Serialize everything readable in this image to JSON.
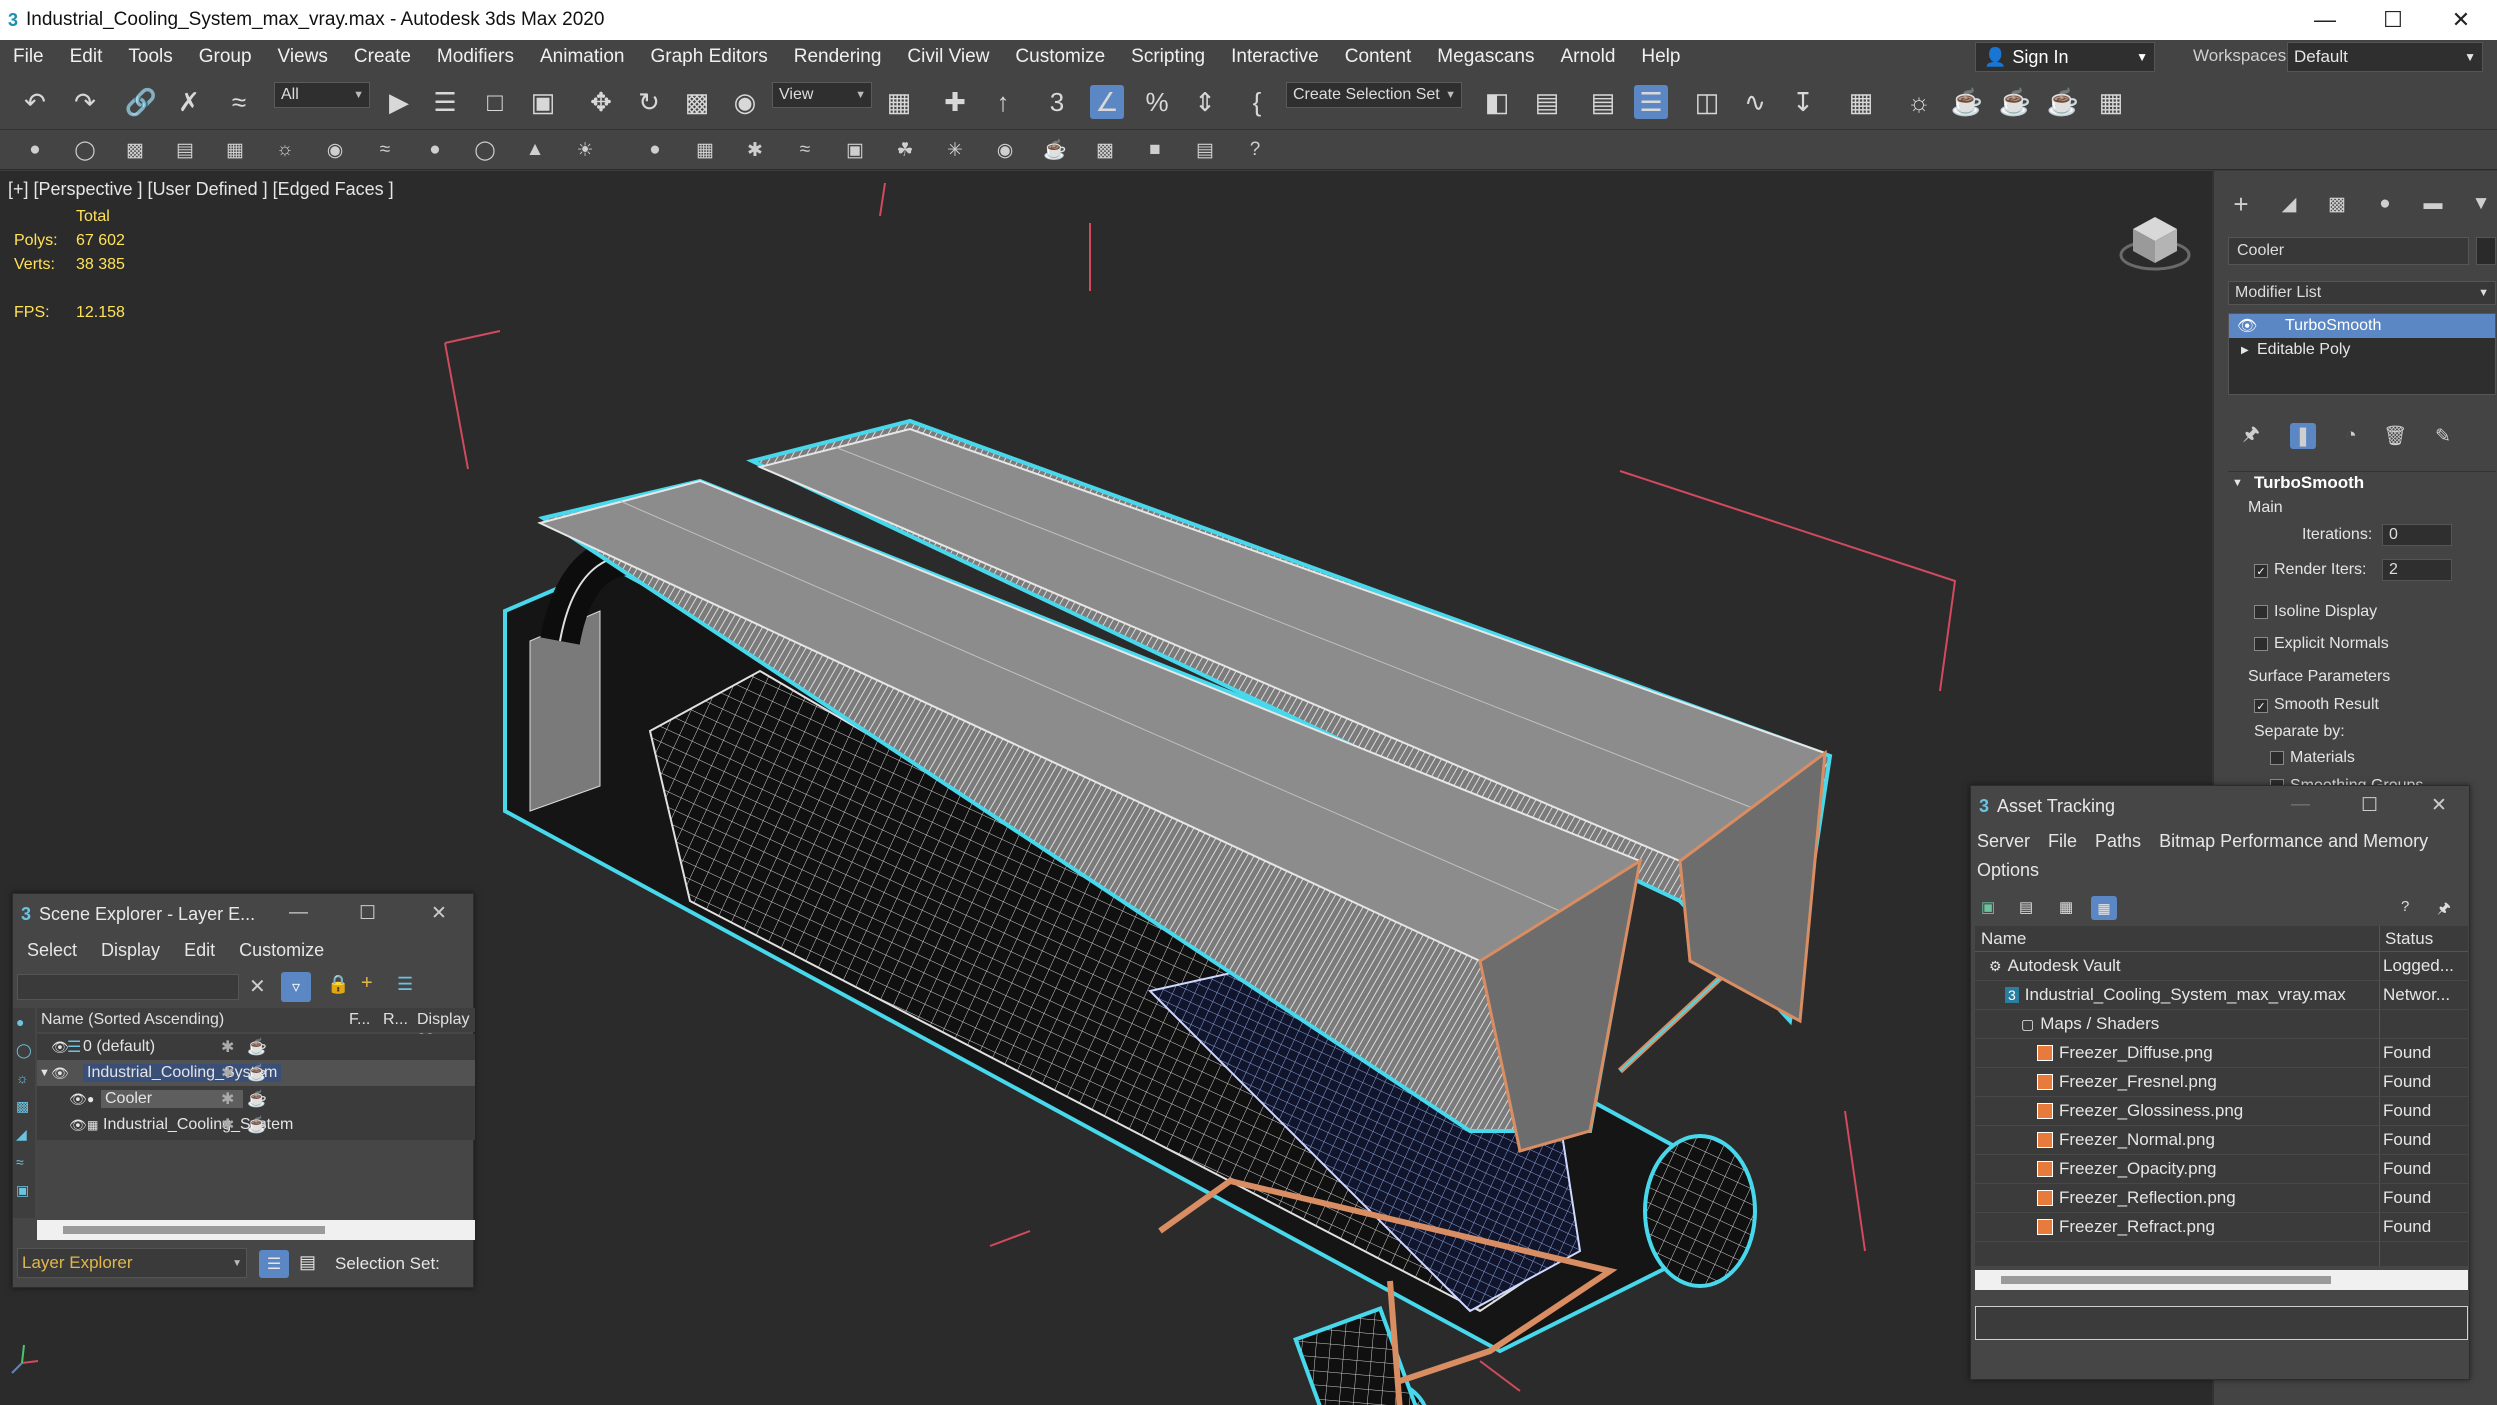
{
  "window": {
    "title": "Industrial_Cooling_System_max_vray.max - Autodesk 3ds Max 2020"
  },
  "menu": [
    "File",
    "Edit",
    "Tools",
    "Group",
    "Views",
    "Create",
    "Modifiers",
    "Animation",
    "Graph Editors",
    "Rendering",
    "Civil View",
    "Customize",
    "Scripting",
    "Interactive",
    "Content",
    "Megascans",
    "Arnold",
    "Help"
  ],
  "account": {
    "sign_in": "Sign In",
    "workspaces_label": "Workspaces:",
    "workspace_value": "Default"
  },
  "toolbar": {
    "filter_value": "All",
    "ref_coord": "View",
    "selection_set_placeholder": "Create Selection Set",
    "snap_number": "3"
  },
  "viewport": {
    "label": "[+] [Perspective ] [User Defined ] [Edged Faces ]",
    "stats": {
      "header": "Total",
      "polys_label": "Polys:",
      "polys": "67 602",
      "verts_label": "Verts:",
      "verts": "38 385",
      "fps_label": "FPS:",
      "fps": "12.158"
    }
  },
  "command_panel": {
    "object_name": "Cooler",
    "modifier_list": "Modifier List",
    "stack": [
      "TurboSmooth",
      "Editable Poly"
    ],
    "rollout": "TurboSmooth",
    "main_label": "Main",
    "iterations_label": "Iterations:",
    "iterations": "0",
    "render_iters_label": "Render Iters:",
    "render_iters": "2",
    "render_iters_checked": true,
    "isoline_label": "Isoline Display",
    "explicit_normals_label": "Explicit Normals",
    "surface_params_label": "Surface Parameters",
    "smooth_result_label": "Smooth Result",
    "smooth_result_checked": true,
    "separate_by_label": "Separate by:",
    "materials_label": "Materials",
    "smoothing_groups_label": "Smoothing Groups"
  },
  "scene_explorer": {
    "title": "Scene Explorer - Layer E...",
    "menu": [
      "Select",
      "Display",
      "Edit",
      "Customize"
    ],
    "columns": {
      "name": "Name (Sorted Ascending)",
      "f": "F...",
      "r": "R...",
      "display": "Display as"
    },
    "rows": [
      {
        "label": "0 (default)",
        "indent": 0
      },
      {
        "label": "Industrial_Cooling_System",
        "indent": 0
      },
      {
        "label": "Cooler",
        "indent": 1
      },
      {
        "label": "Industrial_Cooling_System",
        "indent": 1
      }
    ],
    "footer_layer": "Layer Explorer",
    "footer_selection": "Selection Set:"
  },
  "asset_tracking": {
    "title": "Asset Tracking",
    "menu": [
      "Server",
      "File",
      "Paths",
      "Bitmap Performance and Memory"
    ],
    "menu2": "Options",
    "columns": {
      "name": "Name",
      "status": "Status"
    },
    "rows": [
      {
        "name": "Autodesk Vault",
        "status": "Logged...",
        "indent": 0,
        "icon": "vault-icon"
      },
      {
        "name": "Industrial_Cooling_System_max_vray.max",
        "status": "Networ...",
        "indent": 1,
        "icon": "max-file-icon"
      },
      {
        "name": "Maps / Shaders",
        "status": "",
        "indent": 2,
        "icon": "folder-icon"
      },
      {
        "name": "Freezer_Diffuse.png",
        "status": "Found",
        "indent": 3,
        "icon": "image-file-icon"
      },
      {
        "name": "Freezer_Fresnel.png",
        "status": "Found",
        "indent": 3,
        "icon": "image-file-icon"
      },
      {
        "name": "Freezer_Glossiness.png",
        "status": "Found",
        "indent": 3,
        "icon": "image-file-icon"
      },
      {
        "name": "Freezer_Normal.png",
        "status": "Found",
        "indent": 3,
        "icon": "image-file-icon"
      },
      {
        "name": "Freezer_Opacity.png",
        "status": "Found",
        "indent": 3,
        "icon": "image-file-icon"
      },
      {
        "name": "Freezer_Reflection.png",
        "status": "Found",
        "indent": 3,
        "icon": "image-file-icon"
      },
      {
        "name": "Freezer_Refract.png",
        "status": "Found",
        "indent": 3,
        "icon": "image-file-icon"
      }
    ]
  },
  "colors": {
    "accent": "#5b87c4",
    "selection_outline": "#48d8ec",
    "stats_text": "#ffe25a"
  }
}
